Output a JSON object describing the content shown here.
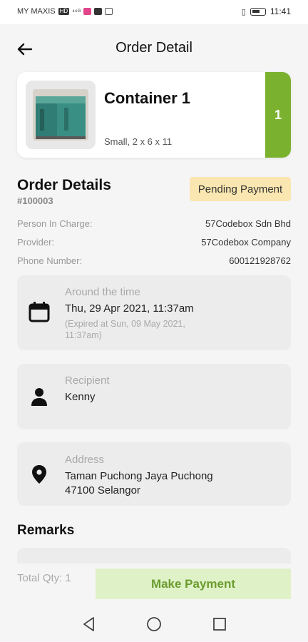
{
  "status_bar": {
    "carrier": "MY MAXIS",
    "badge": "HD",
    "signal": "⁴⁶ᴳ",
    "time": "11:41"
  },
  "header": {
    "title": "Order Detail"
  },
  "product": {
    "name": "Container 1",
    "size": "Small, 2 x 6 x 11",
    "quantity": "1"
  },
  "order": {
    "section_title": "Order Details",
    "order_number": "#100003",
    "status": "Pending Payment",
    "fields": [
      {
        "label": "Person In Charge:",
        "value": "57Codebox Sdn Bhd"
      },
      {
        "label": "Provider:",
        "value": "57Codebox Company"
      },
      {
        "label": "Phone Number:",
        "value": "600121928762"
      }
    ]
  },
  "time_box": {
    "label": "Around the time",
    "value": "Thu, 29 Apr 2021, 11:37am",
    "note": "(Expired at Sun, 09 May 2021, 11:37am)"
  },
  "recipient_box": {
    "label": "Recipient",
    "value": "Kenny"
  },
  "address_box": {
    "label": "Address",
    "line1": "Taman Puchong Jaya  Puchong",
    "line2": "47100 Selangor"
  },
  "remarks": {
    "title": "Remarks"
  },
  "footer": {
    "total_qty": "Total Qty: 1",
    "pay_button": "Make Payment"
  },
  "colors": {
    "accent_green": "#7ab12f",
    "button_bg": "#dff2c7",
    "button_text": "#6b9b2e",
    "status_badge_bg": "#f9e6b0"
  },
  "icons": {
    "back": "arrow-left-icon",
    "calendar": "calendar-icon",
    "person": "person-icon",
    "location": "location-pin-icon",
    "nav_back": "triangle-back-icon",
    "nav_home": "circle-home-icon",
    "nav_recent": "square-recent-icon"
  }
}
